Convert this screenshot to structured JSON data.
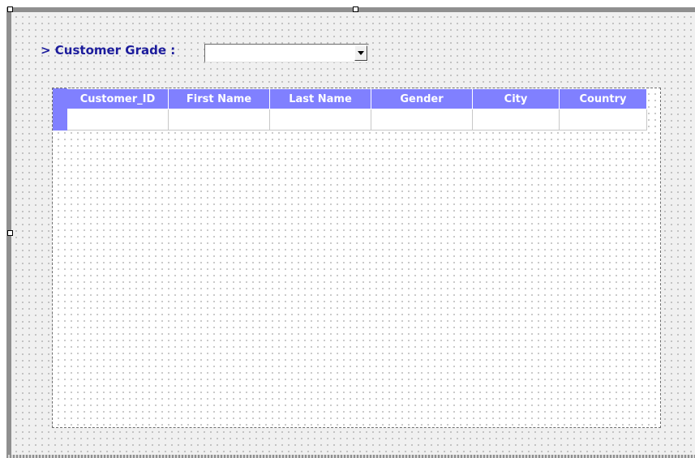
{
  "form": {
    "grade_label": "> Customer Grade :",
    "grade_selected": ""
  },
  "grid": {
    "columns": [
      "Customer_ID",
      "First Name",
      "Last Name",
      "Gender",
      "City",
      "Country"
    ],
    "rows": [
      [
        "",
        "",
        "",
        "",
        "",
        ""
      ]
    ]
  },
  "icons": {
    "dropdown": "chevron-down-icon"
  },
  "colors": {
    "header_bg": "#8080ff",
    "header_text": "#ffffff",
    "label_text": "#1c1c9c",
    "form_bg": "#f0f0f0"
  }
}
